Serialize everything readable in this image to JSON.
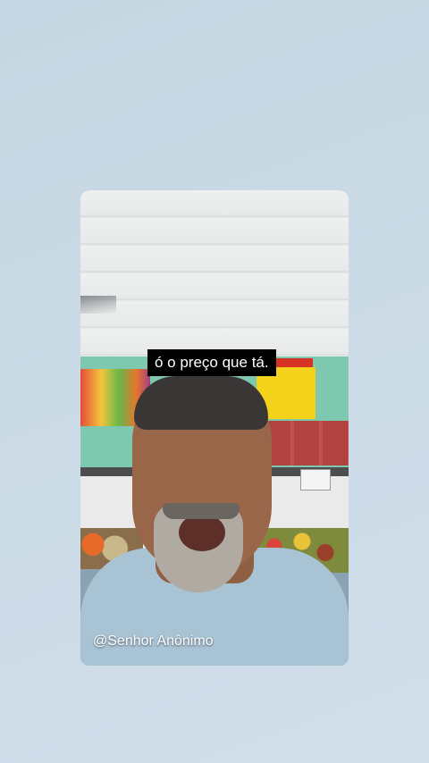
{
  "video": {
    "caption": "ó o preço que tá.",
    "username": "@Senhor Anônimo"
  }
}
